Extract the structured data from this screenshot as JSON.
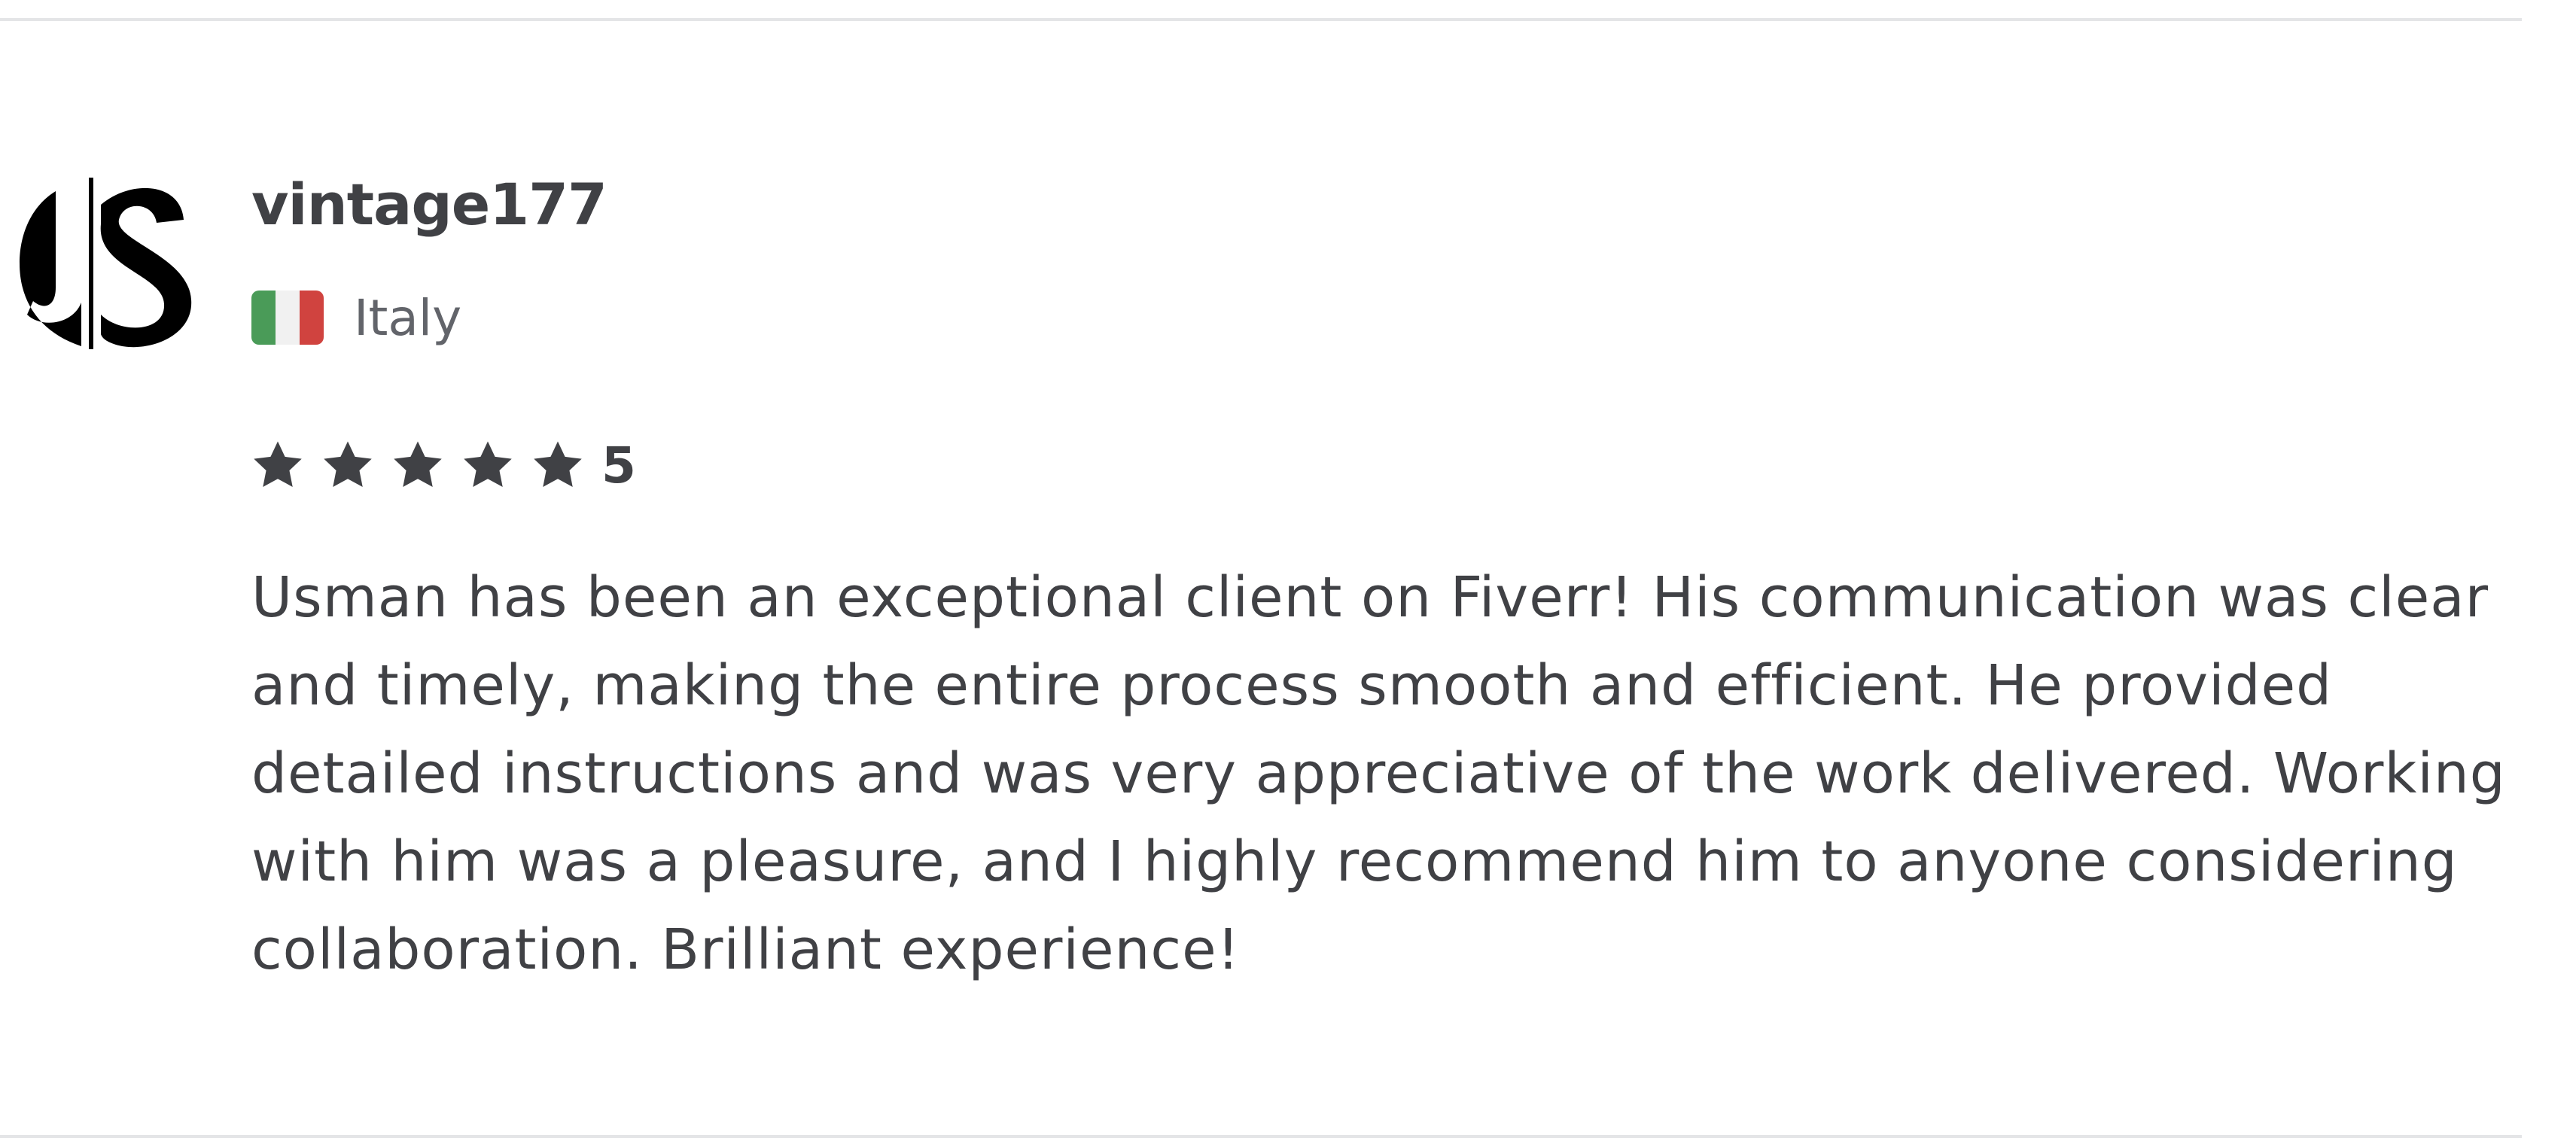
{
  "review": {
    "username": "vintage177",
    "country": "Italy",
    "flag_colors": [
      "#4a9b58",
      "#f1f1f1",
      "#d0433f"
    ],
    "rating": "5",
    "stars": 5,
    "text": "Usman has been an exceptional client on Fiverr! His communication was clear and timely, making the entire process smooth and efficient. He provided detailed instructions and was very appreciative of the work delivered. Working with him was a pleasure, and I highly recommend him to anyone considering collaboration. Brilliant experience!"
  },
  "colors": {
    "text": "#404145",
    "muted": "#62646a",
    "divider": "#e4e5e7",
    "star": "#404145"
  }
}
